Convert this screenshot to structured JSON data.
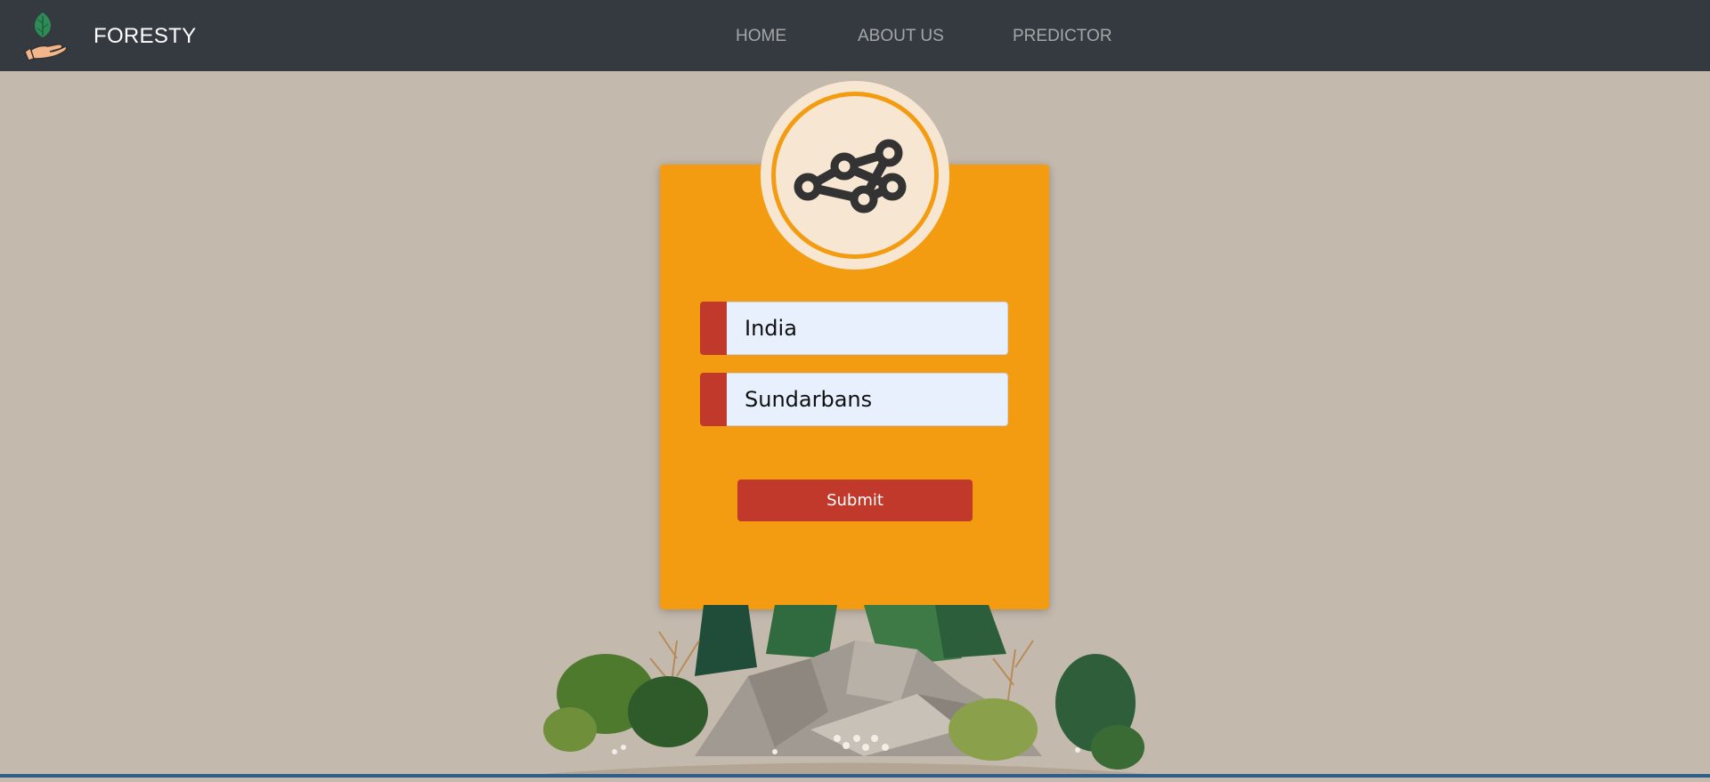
{
  "navbar": {
    "brand": "FORESTY",
    "links": [
      {
        "label": "HOME"
      },
      {
        "label": "ABOUT US"
      },
      {
        "label": "PREDICTOR"
      }
    ]
  },
  "form": {
    "icon": "network-graph-icon",
    "country": {
      "value": "India"
    },
    "region": {
      "value": "Sundarbans"
    },
    "submit_label": "Submit"
  },
  "colors": {
    "navbar_bg": "#343a40",
    "page_bg": "#c4b9ad",
    "card_bg": "#f39c12",
    "accent_red": "#c0392b",
    "input_bg": "#e8f0fe"
  }
}
